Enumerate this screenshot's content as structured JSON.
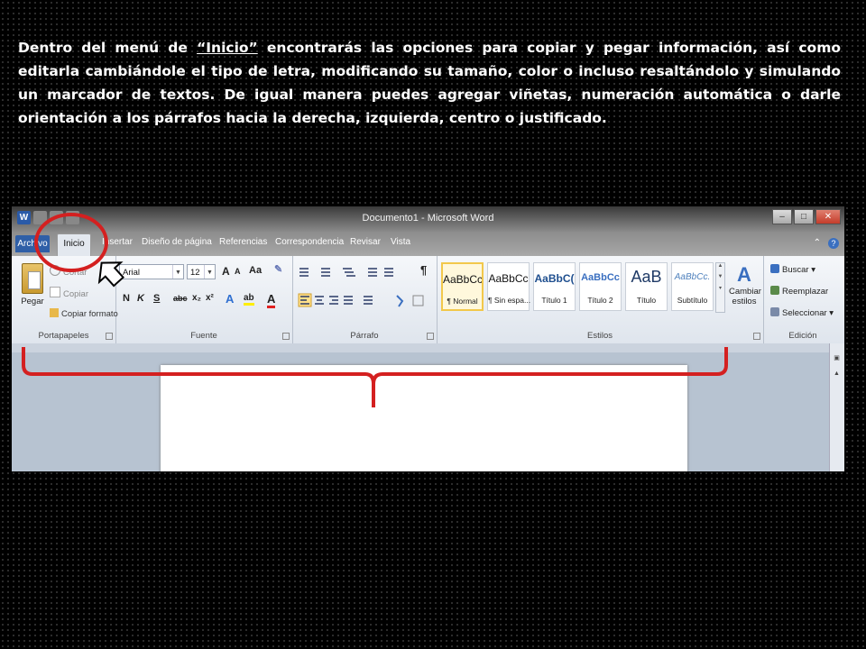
{
  "intro": {
    "before": "Dentro del menú de ",
    "highlight": "“Inicio”",
    "after": " encontrarás las opciones para copiar y pegar información, así como editarla cambiándole el tipo de letra, modificando su tamaño, color o incluso resaltándolo y simulando un marcador de textos. De igual manera puedes agregar viñetas, numeración automática o darle orientación a los párrafos hacia la derecha, izquierda, centro o justificado."
  },
  "window": {
    "title": "Documento1 - Microsoft Word",
    "logo_letter": "W",
    "controls": [
      "–",
      "□",
      "✕"
    ]
  },
  "tabs": {
    "file": "Archivo",
    "active": "Inicio",
    "others": [
      "Insertar",
      "Diseño de página",
      "Referencias",
      "Correspondencia",
      "Revisar",
      "Vista"
    ]
  },
  "ribbon": {
    "portapapeles": {
      "label": "Portapapeles",
      "paste": "Pegar",
      "cut": "Cortar",
      "copy": "Copiar",
      "format_painter": "Copiar formato"
    },
    "fuente": {
      "label": "Fuente",
      "font_name": "Arial",
      "font_size": "12",
      "grow": "A",
      "shrink": "A",
      "case": "Aa",
      "bold": "N",
      "italic": "K",
      "underline": "S",
      "strike": "abc",
      "subscript": "x₂",
      "superscript": "x²",
      "effects": "A",
      "highlight": "ab",
      "font_color": "A"
    },
    "parrafo": {
      "label": "Párrafo",
      "pilcrow": "¶"
    },
    "estilos": {
      "label": "Estilos",
      "items": [
        {
          "sample": "AaBbCc",
          "name": "¶ Normal"
        },
        {
          "sample": "AaBbCc",
          "name": "¶ Sin espa..."
        },
        {
          "sample": "AaBbC(",
          "name": "Título 1"
        },
        {
          "sample": "AaBbCc",
          "name": "Título 2"
        },
        {
          "sample": "AaB",
          "name": "Título"
        },
        {
          "sample": "AaBbCc.",
          "name": "Subtítulo"
        }
      ],
      "change_line1": "Cambiar",
      "change_line2": "estilos"
    },
    "edicion": {
      "label": "Edición",
      "find": "Buscar",
      "replace": "Reemplazar",
      "select": "Seleccionar"
    }
  },
  "colors": {
    "callout_red": "#d42020",
    "active_tab": "#e3e8ef",
    "file_tab": "#2f5fa7",
    "selected_style": "#f2c84b"
  },
  "icons": [
    "pointer-arrow-icon",
    "clipboard-icon",
    "scissors-icon",
    "copy-icon",
    "brush-icon",
    "binoculars-icon",
    "replace-icon",
    "select-icon",
    "help-icon"
  ]
}
